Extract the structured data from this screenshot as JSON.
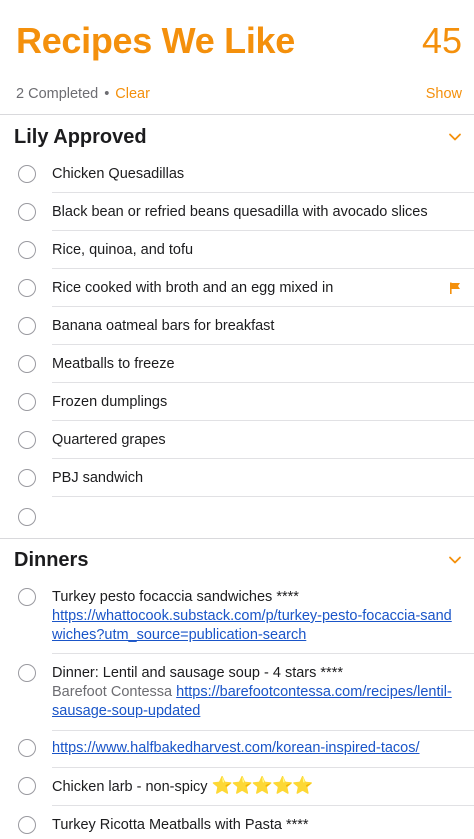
{
  "header": {
    "title": "Recipes We Like",
    "count": "45"
  },
  "status": {
    "completed": "2 Completed",
    "separator": "•",
    "clear": "Clear",
    "show": "Show"
  },
  "sections": [
    {
      "title": "Lily Approved",
      "items": [
        {
          "text": "Chicken Quesadillas"
        },
        {
          "text": "Black bean or refried beans quesadilla with avocado slices"
        },
        {
          "text": "Rice, quinoa, and tofu"
        },
        {
          "text": "Rice cooked with broth and an egg mixed in",
          "flagged": true
        },
        {
          "text": "Banana oatmeal bars for breakfast"
        },
        {
          "text": "Meatballs to freeze"
        },
        {
          "text": "Frozen dumplings"
        },
        {
          "text": "Quartered grapes"
        },
        {
          "text": "PBJ sandwich"
        },
        {
          "text": ""
        }
      ]
    },
    {
      "title": "Dinners",
      "items": [
        {
          "text": "Turkey pesto focaccia sandwiches ****",
          "link": "https://whattocook.substack.com/p/turkey-pesto-focaccia-sandwiches?utm_source=publication-search"
        },
        {
          "text": "Dinner: Lentil and sausage soup - 4 stars ****",
          "note": "Barefoot Contessa",
          "link": "https://barefootcontessa.com/recipes/lentil-sausage-soup-updated"
        },
        {
          "link": "https://www.halfbakedharvest.com/korean-inspired-tacos/"
        },
        {
          "text": "Chicken larb - non-spicy",
          "stars": "⭐⭐⭐⭐⭐"
        },
        {
          "text": "Turkey Ricotta Meatballs with Pasta ****"
        }
      ]
    }
  ],
  "colors": {
    "accent": "#f4900c",
    "link": "#1a55c8"
  },
  "icons": {
    "chevron": "chevron-down-icon",
    "flag": "flag-icon",
    "checkbox": "circle-checkbox"
  }
}
